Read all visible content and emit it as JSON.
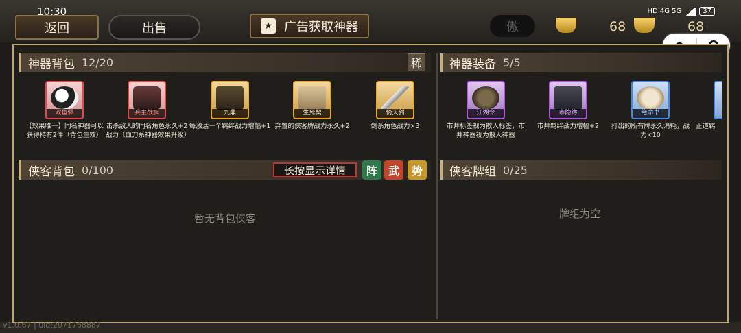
{
  "status": {
    "time": "10:30",
    "battery": "37",
    "net": "HD 4G 5G"
  },
  "topbar": {
    "back_label": "返回",
    "sell_label": "出售",
    "ad_label": "广告获取神器",
    "currency_left": "68",
    "currency_right": "68"
  },
  "artifact_bag": {
    "title": "神器背包",
    "count": "12/20",
    "rarity_button": "稀",
    "items": [
      {
        "name": "双鱼佩",
        "desc": "【效果唯一】同名神器可以获得持有2件（背包生效）",
        "rarity": "red"
      },
      {
        "name": "兵主战旗",
        "desc": "击杀敌人的同名角色永久+2战力（血刀系神器效果升级）",
        "rarity": "red"
      },
      {
        "name": "九鼎",
        "desc": "每激活一个羁绊战力增幅+1",
        "rarity": "gold"
      },
      {
        "name": "生死契",
        "desc": "弃置的侠客牌战力永久+2",
        "rarity": "gold"
      },
      {
        "name": "倚天剑",
        "desc": "剑系角色战力×3",
        "rarity": "gold"
      }
    ]
  },
  "artifact_equip": {
    "title": "神器装备",
    "count": "5/5",
    "items": [
      {
        "name": "江湖令",
        "desc": "市井标签视为散人标签，市井神器视为散人神器",
        "rarity": "purple"
      },
      {
        "name": "市隐簿",
        "desc": "市井羁绊战力增幅+2",
        "rarity": "purple"
      },
      {
        "name": "绝命书",
        "desc": "打出的所有牌永久消耗，战力×10",
        "rarity": "blue"
      },
      {
        "name": "",
        "desc": "正道羁",
        "rarity": "blue"
      }
    ]
  },
  "hero_bag": {
    "title": "侠客背包",
    "count": "0/100",
    "detail_button": "长按显示详情",
    "tags": [
      "阵",
      "武",
      "势"
    ],
    "empty_text": "暂无背包侠客"
  },
  "hero_deck": {
    "title": "侠客牌组",
    "count": "0/25",
    "empty_text": "牌组为空"
  },
  "version": "v1.0.67 | uid:2071768887",
  "colors": {
    "panel_border": "#bfa673",
    "accent_red": "#c1342f",
    "gold": "#e7d6a4"
  }
}
